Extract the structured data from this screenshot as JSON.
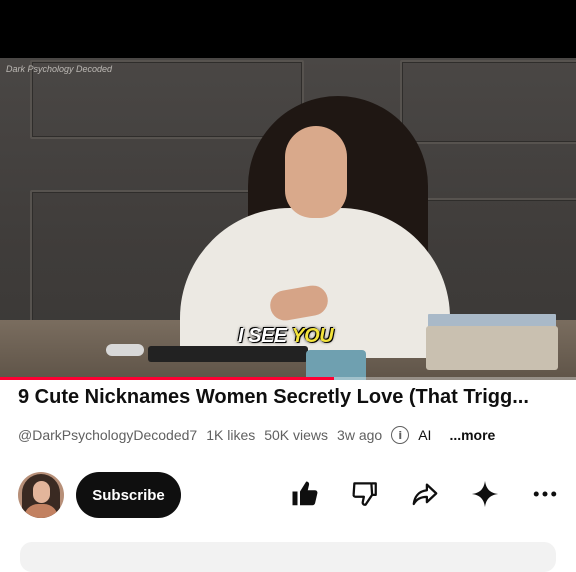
{
  "video": {
    "watermark": "Dark Psychology Decoded",
    "caption": {
      "part1": "I SEE",
      "part2": "YOU"
    },
    "progress_fraction": 0.58,
    "caption_colors": {
      "primary": "#ffffff",
      "highlight": "#f3e33c"
    },
    "progress_color": "#ff0033"
  },
  "info": {
    "title": "9 Cute Nicknames Women Secretly Love (That Trigg...",
    "channel_handle": "@DarkPsychologyDecoded7",
    "likes": "1K likes",
    "views": "50K views",
    "age": "3w ago",
    "ai_label": "AI",
    "more_label": "...more"
  },
  "actions": {
    "subscribe_label": "Subscribe",
    "icons": [
      "thumbs-up-icon",
      "thumbs-down-icon",
      "share-icon",
      "sparkle-icon",
      "more-options-icon"
    ]
  }
}
